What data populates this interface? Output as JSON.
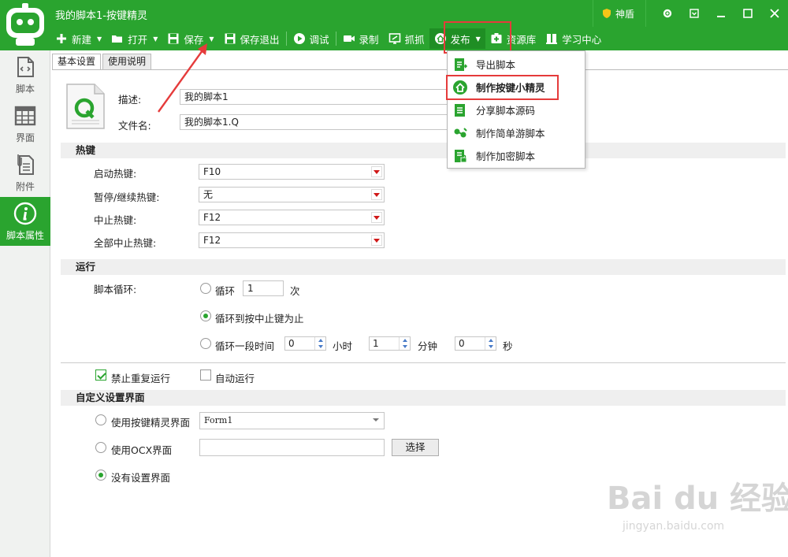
{
  "window": {
    "title": "我的脚本1-按键精灵",
    "shield_label": "神盾"
  },
  "toolbar": {
    "new": "新建",
    "open": "打开",
    "save": "保存",
    "save_exit": "保存退出",
    "debug": "调试",
    "record": "录制",
    "capture": "抓抓",
    "publish": "发布",
    "resources": "资源库",
    "learning": "学习中心"
  },
  "sidebar": {
    "items": [
      {
        "label": "脚本",
        "icon": "script-icon"
      },
      {
        "label": "界面",
        "icon": "layout-icon"
      },
      {
        "label": "附件",
        "icon": "attachment-icon"
      },
      {
        "label": "脚本属性",
        "icon": "info-icon"
      }
    ],
    "active": "脚本属性"
  },
  "tabs": {
    "basic": "基本设置",
    "help": "使用说明"
  },
  "file": {
    "desc_label": "描述:",
    "desc_value": "我的脚本1",
    "name_label": "文件名:",
    "name_value": "我的脚本1.Q"
  },
  "hotkeys": {
    "section": "热键",
    "start_label": "启动热键:",
    "start_value": "F10",
    "pause_label": "暂停/继续热键:",
    "pause_value": "无",
    "stop_label": "中止热键:",
    "stop_value": "F12",
    "stop_all_label": "全部中止热键:",
    "stop_all_value": "F12"
  },
  "run": {
    "section": "运行",
    "loop_label": "脚本循环:",
    "loop_opt": "循环",
    "loop_count": "1",
    "loop_unit": "次",
    "until_stop": "循环到按中止键为止",
    "duration_opt": "循环一段时间",
    "hours": "0",
    "hours_unit": "小时",
    "minutes": "1",
    "minutes_unit": "分钟",
    "seconds": "0",
    "seconds_unit": "秒",
    "no_repeat": "禁止重复运行",
    "auto_run": "自动运行"
  },
  "custom_ui": {
    "section": "自定义设置界面",
    "use_builtin": "使用按键精灵界面",
    "form_value": "Form1",
    "use_ocx": "使用OCX界面",
    "select_btn": "选择",
    "none": "没有设置界面"
  },
  "publish_menu": {
    "items": [
      "导出脚本",
      "制作按键小精灵",
      "分享脚本源码",
      "制作简单游脚本",
      "制作加密脚本"
    ]
  },
  "watermark": {
    "text": "Bai du 经验",
    "url": "jingyan.baidu.com"
  },
  "colors": {
    "brand_green": "#2aa42f",
    "highlight_red": "#e53b3b"
  }
}
